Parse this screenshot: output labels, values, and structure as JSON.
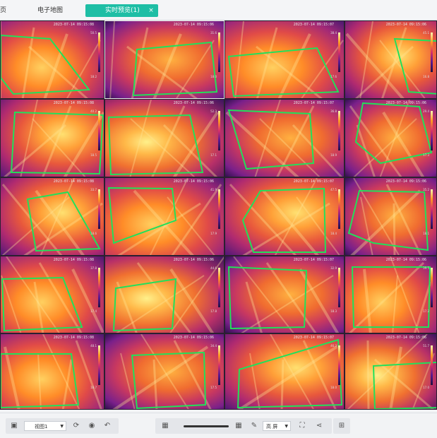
{
  "tabs": [
    {
      "label": "页",
      "active": false
    },
    {
      "label": "电子地图",
      "active": false
    },
    {
      "label": "实时预览(1)",
      "active": true,
      "close": "×"
    }
  ],
  "cells": [
    {
      "cam": "",
      "ts": "2023-07-14 09:15:08",
      "bg": "a",
      "poly": "0,20 70,25 125,97 18,103 0,80",
      "max": "50.5",
      "min": "18.2"
    },
    {
      "cam": "",
      "ts": "2023-07-14 09:15:06",
      "bg": "b",
      "poly": "45,40 150,30 158,100 40,105",
      "max": "31.6",
      "min": "18.0"
    },
    {
      "cam": "",
      "ts": "2023-07-14 09:15:07",
      "bg": "a",
      "poly": "5,50 130,38 160,100 12,106",
      "max": "38.4",
      "min": "17.6"
    },
    {
      "cam": "",
      "ts": "2023-07-14 09:15:06",
      "bg": "c",
      "poly": "70,25 130,28 160,105 90,100",
      "max": "45.1",
      "min": "16.8"
    },
    {
      "cam": "",
      "ts": "2023-07-14 09:15:08",
      "bg": "c",
      "poly": "20,18 145,22 140,105 15,103",
      "max": "40.2",
      "min": "18.5"
    },
    {
      "cam": "",
      "ts": "2023-07-14 09:15:06",
      "bg": "d",
      "poly": "5,25 120,22 138,103 8,106",
      "max": "52.3",
      "min": "17.1"
    },
    {
      "cam": "",
      "ts": "2023-07-14 09:15:07",
      "bg": "b",
      "poly": "5,15 120,20 125,90 30,98",
      "max": "36.8",
      "min": "18.9"
    },
    {
      "cam": "",
      "ts": "2023-07-14 09:15:06",
      "bg": "b",
      "poly": "25,5 105,10 122,75 50,90 15,60",
      "max": "29.4",
      "min": "17.3"
    },
    {
      "cam": "",
      "ts": "2023-07-14 09:15:08",
      "bg": "c",
      "poly": "38,30 95,20 140,100 50,103",
      "max": "33.7",
      "min": "18.6"
    },
    {
      "cam": "",
      "ts": "2023-07-14 09:15:06",
      "bg": "a",
      "poly": "5,14 95,15 100,60 12,92",
      "max": "41.9",
      "min": "17.9"
    },
    {
      "cam": "",
      "ts": "2023-07-14 09:15:07",
      "bg": "c",
      "poly": "50,18 140,15 142,105 40,105 25,60",
      "max": "47.5",
      "min": "18.4"
    },
    {
      "cam": "",
      "ts": "2023-07-14 09:15:06",
      "bg": "b",
      "poly": "20,18 112,20 117,102 40,92 5,78",
      "max": "35.2",
      "min": "18.1"
    },
    {
      "cam": "",
      "ts": "2023-07-14 09:15:08",
      "bg": "a",
      "poly": "2,32 88,30 115,100 5,105",
      "max": "37.8",
      "min": "17.4"
    },
    {
      "cam": "",
      "ts": "2023-07-14 09:15:06",
      "bg": "d",
      "poly": "15,45 100,32 95,102 12,105",
      "max": "44.6",
      "min": "17.8"
    },
    {
      "cam": "",
      "ts": "2023-07-14 09:15:07",
      "bg": "b",
      "poly": "5,15 115,20 112,100 8,102",
      "max": "32.9",
      "min": "18.3"
    },
    {
      "cam": "",
      "ts": "2023-07-14 09:15:06",
      "bg": "a",
      "poly": "10,15 120,15 118,100 12,100",
      "max": "39.5",
      "min": "17.2"
    },
    {
      "cam": "",
      "ts": "2023-07-14 09:15:08",
      "bg": "a",
      "poly": "0,28 100,28 110,100 0,104",
      "max": "48.1",
      "min": "18.7"
    },
    {
      "cam": "",
      "ts": "2023-07-14 09:15:06",
      "bg": "b",
      "poly": "38,30 140,26 142,100 45,105",
      "max": "34.4",
      "min": "17.5"
    },
    {
      "cam": "",
      "ts": "2023-07-14 09:15:07",
      "bg": "c",
      "poly": "20,50 160,8 165,100 18,104",
      "max": "46.3",
      "min": "18.0"
    },
    {
      "cam": "",
      "ts": "2023-07-14 09:15:06",
      "bg": "d",
      "poly": "40,45 130,40 132,104 42,106",
      "max": "51.7",
      "min": "17.0"
    }
  ],
  "toolbar": {
    "save_icon": "save-icon",
    "layout_select": "视图1",
    "slider_level": 0.55,
    "stream_select": "高 屏",
    "icons": [
      "save-icon",
      "calendar-icon",
      "refresh-icon",
      "record-icon",
      "undo-icon",
      "grid-small-icon",
      "grid-large-icon",
      "fullscreen-icon",
      "share-icon",
      "layout-icon"
    ]
  },
  "colors": {
    "accent": "#1ebea5",
    "outline": "#22e05a"
  }
}
